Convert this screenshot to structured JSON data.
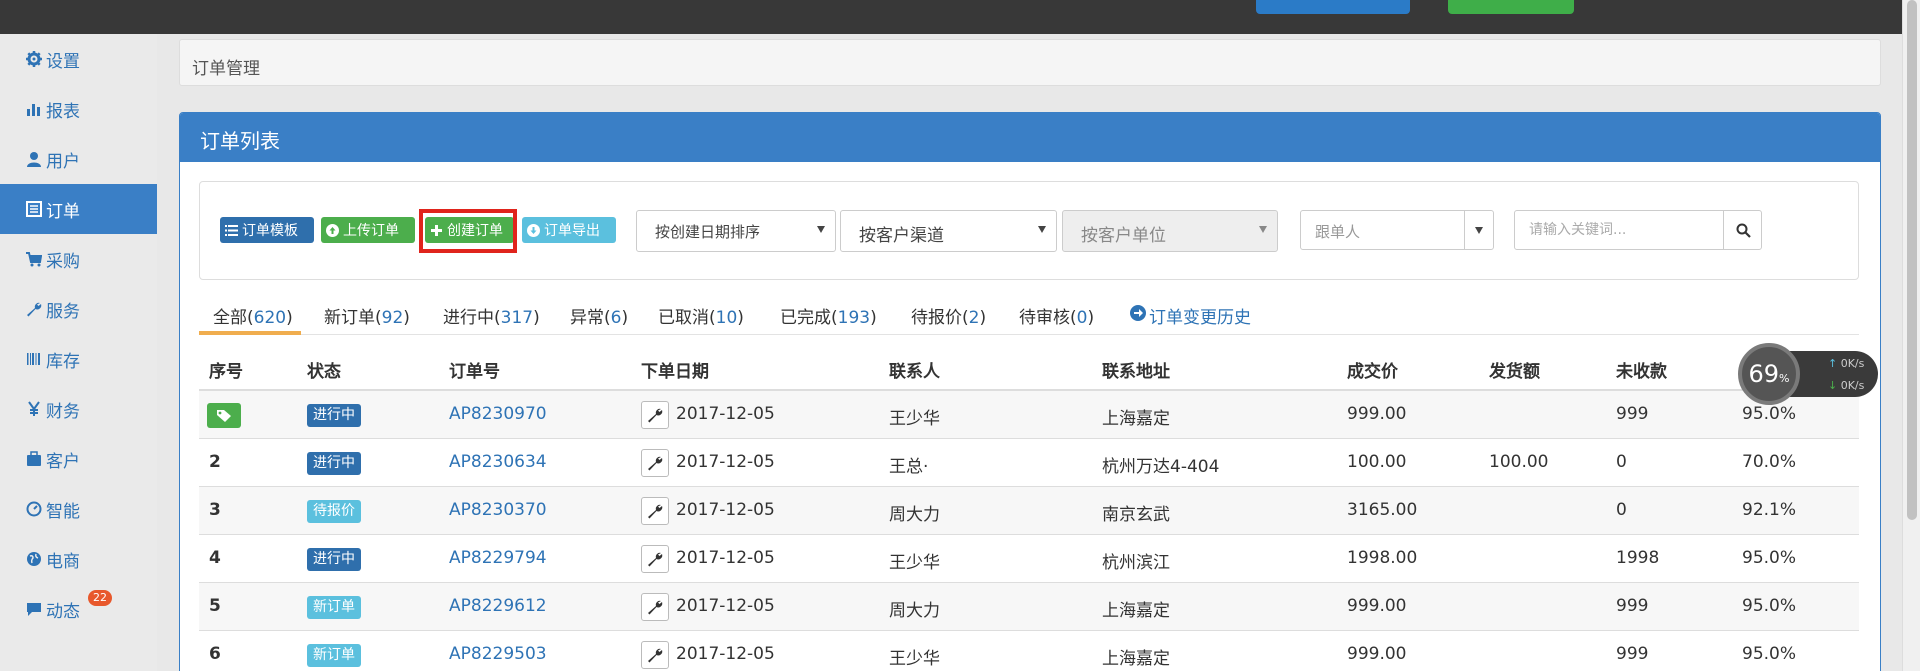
{
  "sidebar": {
    "items": [
      {
        "label": "设置",
        "icon": "gear-icon"
      },
      {
        "label": "报表",
        "icon": "bar-chart-icon"
      },
      {
        "label": "用户",
        "icon": "user-icon"
      },
      {
        "label": "订单",
        "icon": "list-alt-icon",
        "active": true
      },
      {
        "label": "采购",
        "icon": "cart-icon"
      },
      {
        "label": "服务",
        "icon": "wrench-icon"
      },
      {
        "label": "库存",
        "icon": "barcode-icon"
      },
      {
        "label": "财务",
        "icon": "yen-icon"
      },
      {
        "label": "客户",
        "icon": "briefcase-icon"
      },
      {
        "label": "智能",
        "icon": "dashboard-icon"
      },
      {
        "label": "电商",
        "icon": "globe-icon"
      },
      {
        "label": "动态",
        "icon": "comment-icon",
        "badge": "22"
      }
    ]
  },
  "breadcrumb": "订单管理",
  "panel": {
    "title": "订单列表"
  },
  "toolbar": {
    "template_btn": "订单模板",
    "upload_btn": "上传订单",
    "create_btn": "创建订单",
    "export_btn": "订单导出",
    "sort_select": "按创建日期排序",
    "channel_select": "按客户渠道",
    "unit_select": "按客户单位",
    "follower_placeholder": "跟单人",
    "search_placeholder": "请输入关键词..."
  },
  "tabs": [
    {
      "label": "全部",
      "count": "620",
      "active": true
    },
    {
      "label": "新订单",
      "count": "92"
    },
    {
      "label": "进行中",
      "count": "317"
    },
    {
      "label": "异常",
      "count": "6"
    },
    {
      "label": "已取消",
      "count": "10"
    },
    {
      "label": "已完成",
      "count": "193"
    },
    {
      "label": "待报价",
      "count": "2"
    },
    {
      "label": "待审核",
      "count": "0"
    }
  ],
  "history_link": "订单变更历史",
  "table": {
    "headers": [
      "序号",
      "状态",
      "订单号",
      "下单日期",
      "联系人",
      "联系地址",
      "成交价",
      "发货额",
      "未收款"
    ],
    "rows": [
      {
        "no": "",
        "status": "进行中",
        "order": "AP8230970",
        "date": "2017-12-05",
        "contact": "王少华",
        "address": "上海嘉定",
        "price": "999.00",
        "shipped": "",
        "unpaid": "999",
        "pct": "95.0%"
      },
      {
        "no": "2",
        "status": "进行中",
        "order": "AP8230634",
        "date": "2017-12-05",
        "contact": "王总·",
        "address": "杭州万达4-404",
        "price": "100.00",
        "shipped": "100.00",
        "unpaid": "0",
        "pct": "70.0%"
      },
      {
        "no": "3",
        "status": "待报价",
        "order": "AP8230370",
        "date": "2017-12-05",
        "contact": "周大力",
        "address": "南京玄武",
        "price": "3165.00",
        "shipped": "",
        "unpaid": "0",
        "pct": "92.1%"
      },
      {
        "no": "4",
        "status": "进行中",
        "order": "AP8229794",
        "date": "2017-12-05",
        "contact": "王少华",
        "address": "杭州滨江",
        "price": "1998.00",
        "shipped": "",
        "unpaid": "1998",
        "pct": "95.0%"
      },
      {
        "no": "5",
        "status": "新订单",
        "order": "AP8229612",
        "date": "2017-12-05",
        "contact": "周大力",
        "address": "上海嘉定",
        "price": "999.00",
        "shipped": "",
        "unpaid": "999",
        "pct": "95.0%"
      },
      {
        "no": "6",
        "status": "新订单",
        "order": "AP8229503",
        "date": "2017-12-05",
        "contact": "王少华",
        "address": "上海嘉定",
        "price": "999.00",
        "shipped": "",
        "unpaid": "999",
        "pct": "95.0%"
      }
    ]
  },
  "net_widget": {
    "percent": "69",
    "unit": "%",
    "up": "0K/s",
    "down": "0K/s"
  }
}
